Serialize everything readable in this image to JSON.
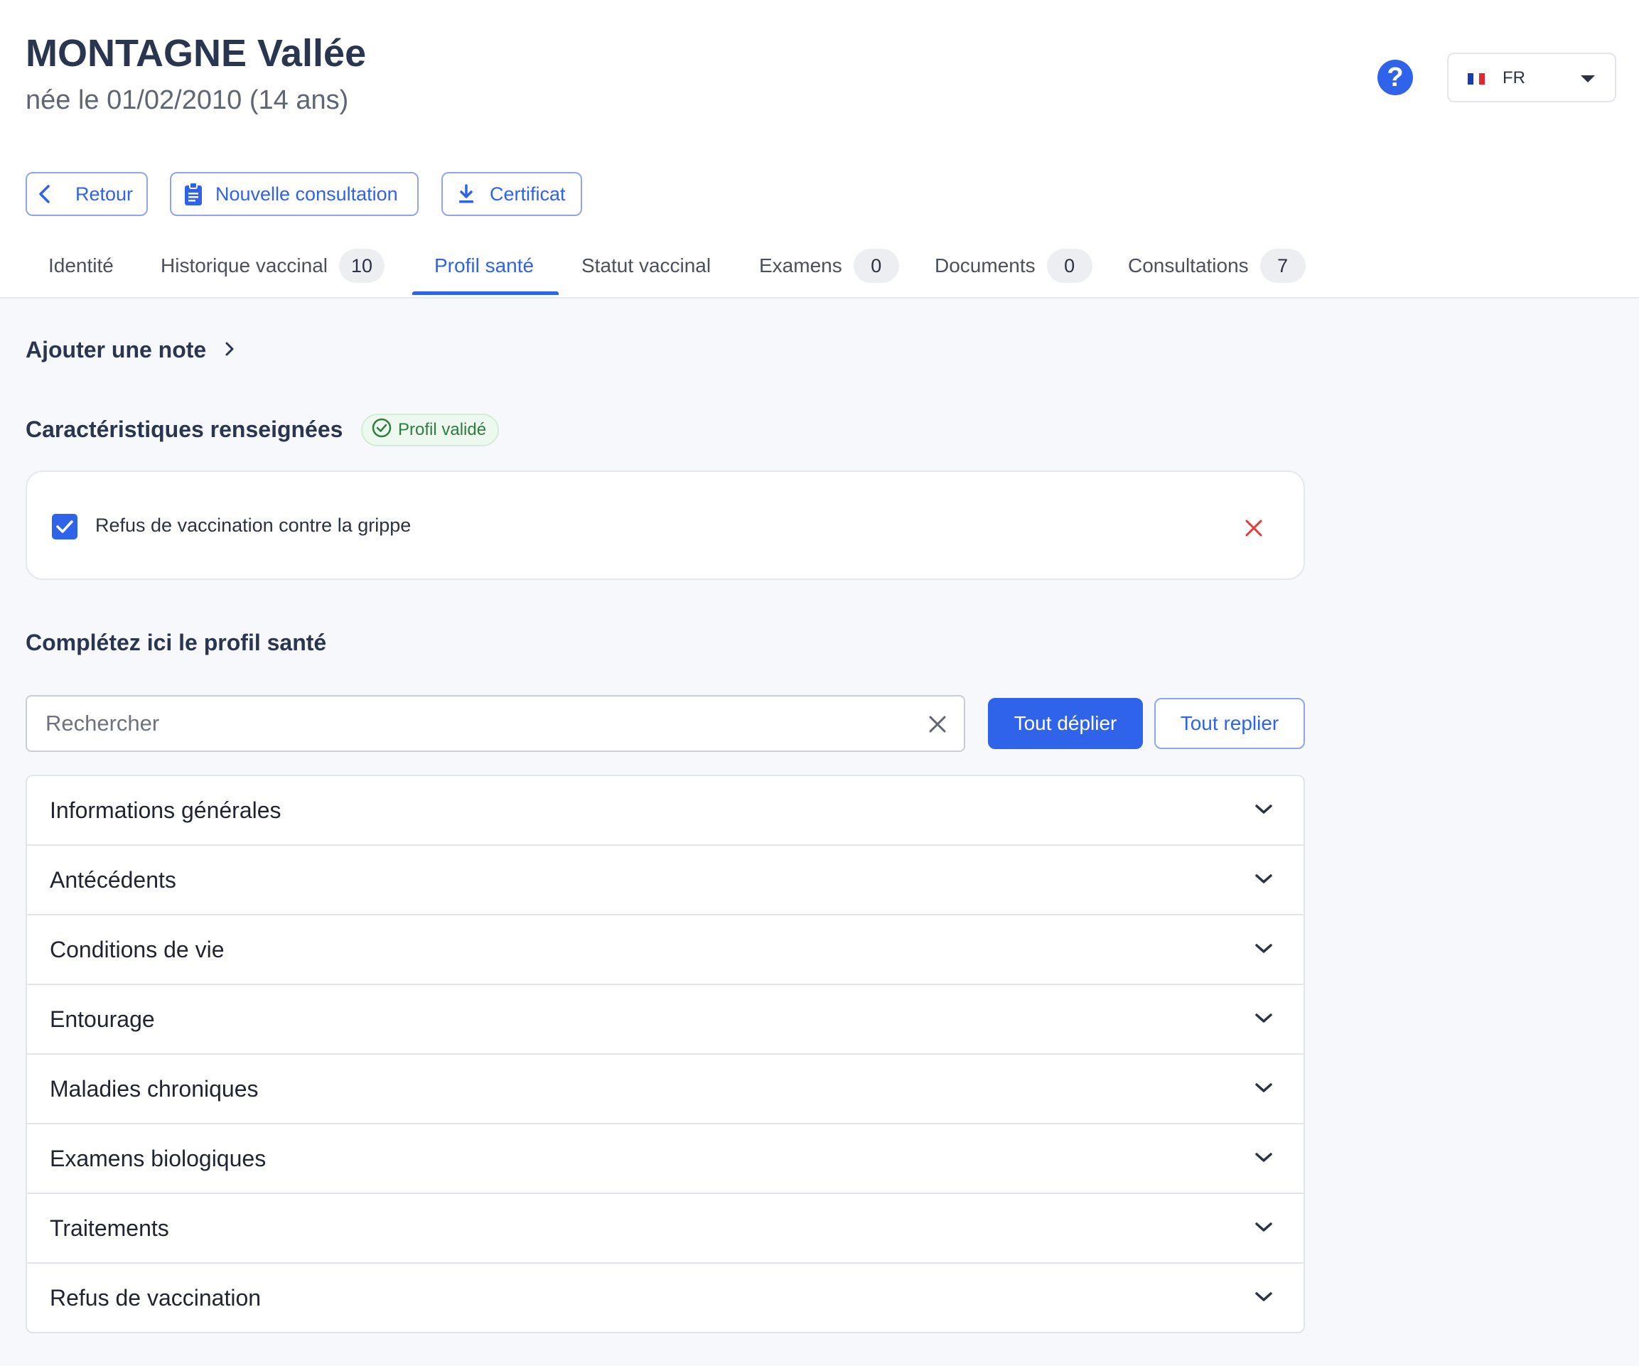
{
  "patient": {
    "name": "MONTAGNE Vallée",
    "dob": "née le 01/02/2010 (14 ans)"
  },
  "header": {
    "help_icon": "question-circle-icon",
    "language": "FR",
    "flag_colors": [
      "#1a3bb5",
      "#ffffff",
      "#e3262e"
    ]
  },
  "actions": {
    "back_label": "Retour",
    "new_consultation_label": "Nouvelle consultation",
    "certificate_label": "Certificat"
  },
  "tabs": [
    {
      "label": "Identité"
    },
    {
      "label": "Historique vaccinal",
      "count": "10"
    },
    {
      "label": "Profil santé",
      "active": true
    },
    {
      "label": "Statut vaccinal"
    },
    {
      "label": "Examens",
      "count": "0"
    },
    {
      "label": "Documents",
      "count": "0"
    },
    {
      "label": "Consultations",
      "count": "7"
    }
  ],
  "add_note": {
    "label": "Ajouter une note"
  },
  "characteristics": {
    "title": "Caractéristiques renseignées",
    "badge": "Profil validé",
    "items": [
      {
        "label": "Refus de vaccination contre la grippe",
        "checked": true
      }
    ]
  },
  "profile": {
    "title": "Complétez ici le profil santé",
    "search_placeholder": "Rechercher",
    "search_value": "",
    "expand_all_label": "Tout déplier",
    "collapse_all_label": "Tout replier",
    "sections": [
      {
        "label": "Informations générales"
      },
      {
        "label": "Antécédents"
      },
      {
        "label": "Conditions de vie"
      },
      {
        "label": "Entourage"
      },
      {
        "label": "Maladies chroniques"
      },
      {
        "label": "Examens biologiques"
      },
      {
        "label": "Traitements"
      },
      {
        "label": "Refus de vaccination"
      }
    ]
  },
  "colors": {
    "primary": "#2f63ea",
    "success": "#2e7d40",
    "danger": "#e53935",
    "title": "#2a3550"
  }
}
